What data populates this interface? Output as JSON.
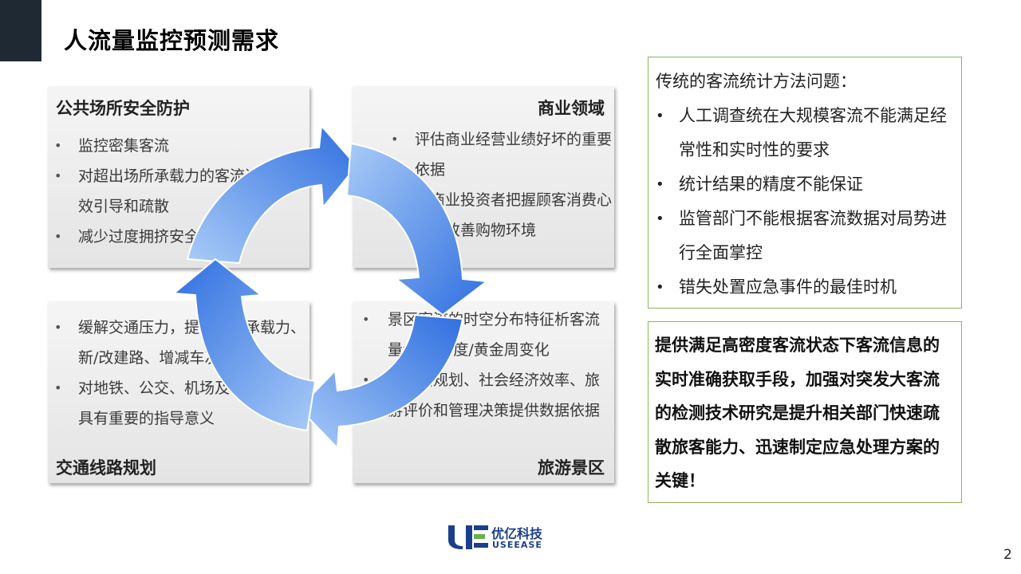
{
  "title": "人流量监控预测需求",
  "quadrants": {
    "top_left": {
      "title": "公共场所安全防护",
      "items": [
        "监控密集客流",
        "对超出场所承载力的客流进行有效引导和疏散",
        "减少过度拥挤安全隐患"
      ]
    },
    "top_right": {
      "title": "商业领域",
      "items": [
        "评估商业经营业绩好坏的重要依据",
        "帮商业投资者把握顾客消费心理，改善购物环境"
      ]
    },
    "bottom_left": {
      "title": "交通线路规划",
      "items": [
        "缓解交通压力，提升运输承载力、新/改建路、增减车次规划",
        "对地铁、公交、机场及铁路等领域具有重要的指导意义"
      ]
    },
    "bottom_right": {
      "title": "旅游景区",
      "items": [
        "景区客流的时空分布特征析客流量年度/季度/黄金周变化",
        "为战略规划、社会经济效率、旅游评价和管理决策提供数据依据"
      ]
    }
  },
  "problems": {
    "heading": "传统的客流统计方法问题：",
    "items": [
      "人工调查统在大规模客流不能满足经常性和实时性的要求",
      "统计结果的精度不能保证",
      "监管部门不能根据客流数据对局势进行全面掌控",
      "错失处置应急事件的最佳时机"
    ]
  },
  "conclusion": "提供满足高密度客流状态下客流信息的实时准确获取手段，加强对突发大客流的检测技术研究是提升相关部门快速疏散旅客能力、迅速制定应急处理方案的关键！",
  "logo": {
    "cn": "优亿科技",
    "en": "USEEASE"
  },
  "page_number": "2",
  "colors": {
    "corner": "#1f2933",
    "arrow_light": "#9cc2f5",
    "arrow_dark": "#2f6fe0",
    "box_border": "#8fb35b",
    "brand": "#1c3f8c"
  }
}
